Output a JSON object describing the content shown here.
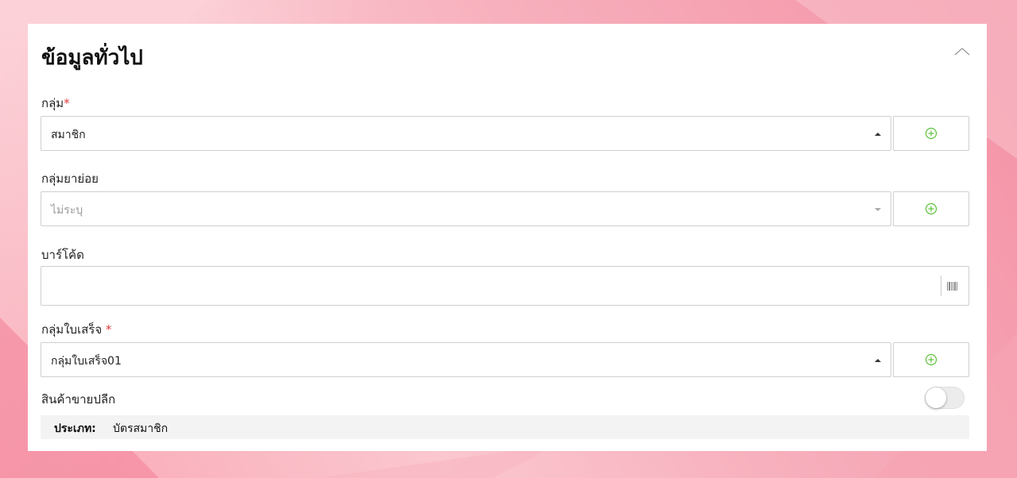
{
  "section": {
    "title": "ข้อมูลทั่วไป",
    "collapse_icon": "chevron-up-icon"
  },
  "fields": {
    "group": {
      "label": "กลุ่ม",
      "required_mark": "*",
      "value": "สมาชิก",
      "add_icon": "plus-circle-icon"
    },
    "subgroup": {
      "label": "กลุ่มยาย่อย",
      "placeholder": "ไม่ระบุ",
      "add_icon": "plus-circle-icon"
    },
    "barcode": {
      "label": "บาร์โค้ด",
      "value": "",
      "icon": "barcode-icon"
    },
    "receipt_group": {
      "label": "กลุ่มใบเสร็จ",
      "required_mark": "*",
      "value": "กลุ่มใบเสร็จ01",
      "add_icon": "plus-circle-icon"
    },
    "retail": {
      "label": "สินค้าขายปลีก",
      "enabled": false
    }
  },
  "info": {
    "type_label": "ประเภท:",
    "type_value": "บัตรสมาชิก"
  },
  "colors": {
    "accent_green": "#5cc23a",
    "required_red": "#e03a3a",
    "background_pink": "#f7b0bd"
  }
}
